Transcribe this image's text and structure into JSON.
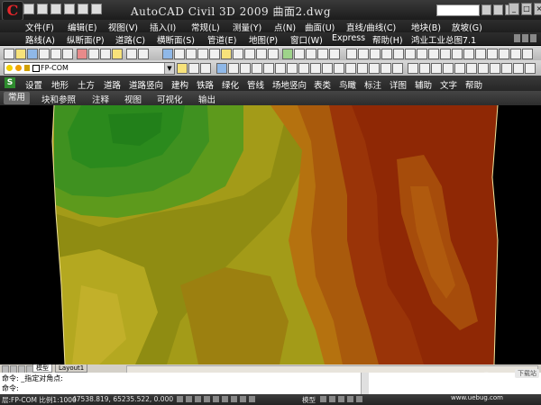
{
  "app": {
    "title": "AutoCAD Civil 3D 2009  曲面2.dwg",
    "logo_letter": "C"
  },
  "menu_row1": [
    "文件(F)",
    "编辑(E)",
    "视图(V)",
    "插入(I)",
    "常规(L)",
    "测量(Y)",
    "点(N)",
    "曲面(U)",
    "直线/曲线(C)",
    "地块(B)",
    "放坡(G)"
  ],
  "menu_row2": [
    "路线(A)",
    "纵断面(P)",
    "道路(C)",
    "横断面(S)",
    "管道(E)",
    "地图(P)",
    "窗口(W)",
    "Express",
    "帮助(H)",
    "鸿业工业总图7.1"
  ],
  "layer_combo": {
    "value": "FP-COM"
  },
  "civil_menu": {
    "icon_label": "S",
    "items": [
      "设置",
      "地形",
      "土方",
      "道路",
      "道路竖向",
      "建构",
      "铁路",
      "绿化",
      "管线",
      "场地竖向",
      "表类",
      "鸟瞰",
      "标注",
      "详图",
      "辅助",
      "文字",
      "帮助"
    ]
  },
  "ribbon_tabs": {
    "items": [
      "常用",
      "块和参照",
      "注释",
      "视图",
      "可视化",
      "输出"
    ],
    "active": "常用"
  },
  "layout_tabs": {
    "model": "模型",
    "layout1": "Layout1"
  },
  "command": {
    "line1": "命令: _指定对角点:",
    "line2": "命令:"
  },
  "status": {
    "layer_text": "层:FP-COM 比例1:1000",
    "coords": "47538.819, 65235.522, 0.000",
    "model_label": "模型"
  },
  "watermark": {
    "logo": "UEBUG",
    "badge": "下载站",
    "site": "www.uebug.com"
  },
  "colors": {
    "surface_green": "#2f8f1e",
    "surface_yellow": "#a5a017",
    "surface_orange": "#b8640f",
    "surface_red": "#9a2a06",
    "boundary_line": "#f2e39a"
  }
}
